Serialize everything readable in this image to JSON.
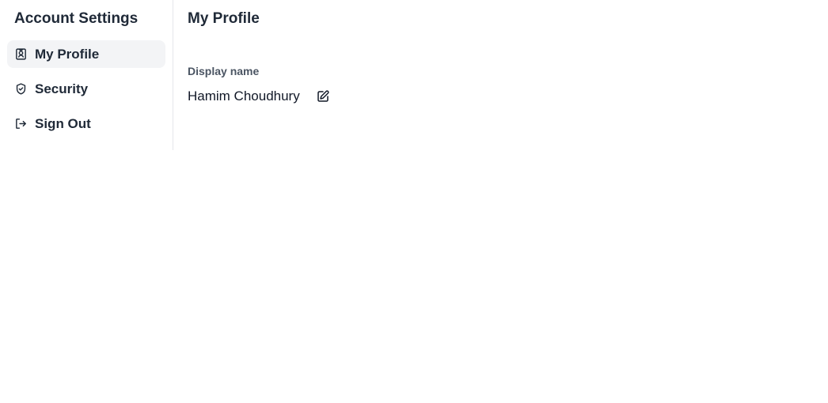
{
  "sidebar": {
    "title": "Account Settings",
    "items": [
      {
        "label": "My Profile",
        "icon": "profile-badge-icon",
        "active": true
      },
      {
        "label": "Security",
        "icon": "shield-check-icon",
        "active": false
      },
      {
        "label": "Sign Out",
        "icon": "sign-out-icon",
        "active": false
      }
    ]
  },
  "main": {
    "title": "My Profile",
    "display_name_label": "Display name",
    "display_name_value": "Hamim Choudhury",
    "edit_icon": "edit-icon"
  }
}
